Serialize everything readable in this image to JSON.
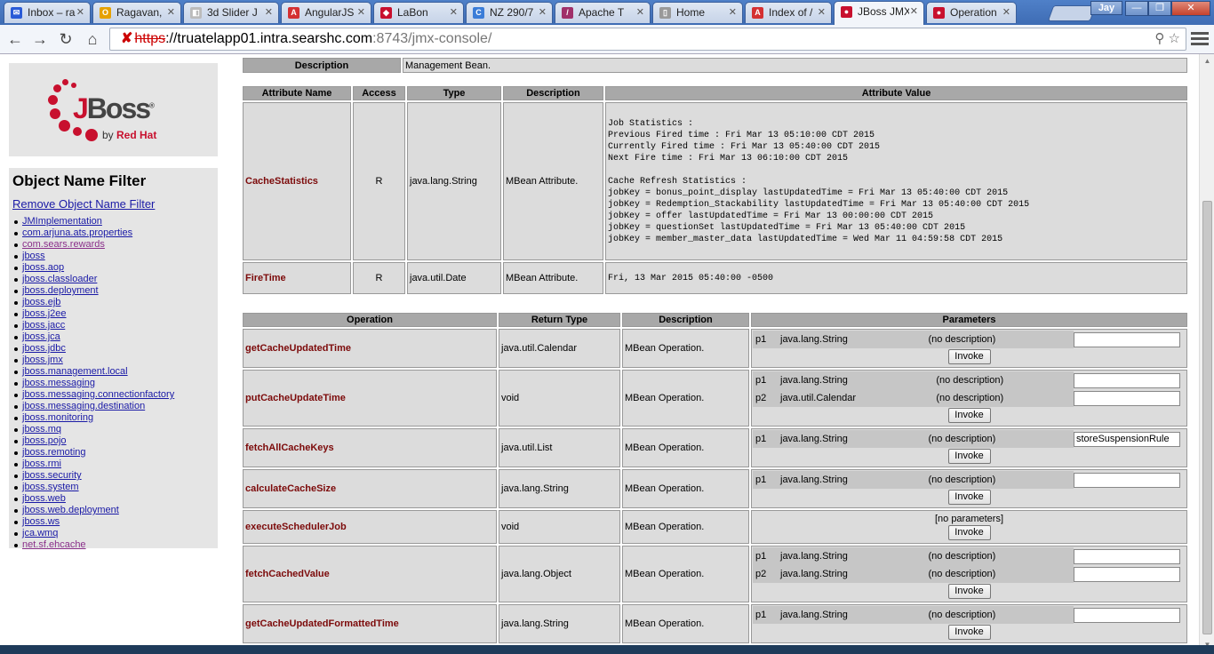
{
  "browser": {
    "tabs": [
      {
        "title": "Inbox – ra",
        "fav_color": "#2a5bd7",
        "fav_glyph": "✉"
      },
      {
        "title": "Ragavan,",
        "fav_color": "#e6a100",
        "fav_glyph": "O"
      },
      {
        "title": "3d Slider J",
        "fav_color": "#bbbbbb",
        "fav_glyph": "◧"
      },
      {
        "title": "AngularJS",
        "fav_color": "#d43032",
        "fav_glyph": "A"
      },
      {
        "title": "LaBon",
        "fav_color": "#c8102e",
        "fav_glyph": "◆"
      },
      {
        "title": "NZ 290/7",
        "fav_color": "#3b7dd8",
        "fav_glyph": "C"
      },
      {
        "title": "Apache T",
        "fav_color": "#a0306a",
        "fav_glyph": "/"
      },
      {
        "title": "Home",
        "fav_color": "#999999",
        "fav_glyph": "▯"
      },
      {
        "title": "Index of /",
        "fav_color": "#d43032",
        "fav_glyph": "A"
      },
      {
        "title": "JBoss JMX",
        "fav_color": "#c8102e",
        "fav_glyph": "●"
      },
      {
        "title": "Operation",
        "fav_color": "#c8102e",
        "fav_glyph": "●"
      }
    ],
    "active_tab_index": 9,
    "user": "Jay",
    "url": {
      "scheme": "https",
      "host": "://truatelapp01.intra.searshc.com",
      "path": ":8743/jmx-console/"
    }
  },
  "logo": {
    "wordmark_a": "J",
    "wordmark_b": "Boss",
    "byline_a": "by ",
    "byline_b": "Red Hat",
    "registered": "®"
  },
  "filter": {
    "heading": "Object Name Filter",
    "remove_label": "Remove Object Name Filter",
    "domains": [
      {
        "name": "JMImplementation",
        "visited": false
      },
      {
        "name": "com.arjuna.ats.properties",
        "visited": false
      },
      {
        "name": "com.sears.rewards",
        "visited": true
      },
      {
        "name": "jboss",
        "visited": false
      },
      {
        "name": "jboss.aop",
        "visited": false
      },
      {
        "name": "jboss.classloader",
        "visited": false
      },
      {
        "name": "jboss.deployment",
        "visited": false
      },
      {
        "name": "jboss.ejb",
        "visited": false
      },
      {
        "name": "jboss.j2ee",
        "visited": false
      },
      {
        "name": "jboss.jacc",
        "visited": false
      },
      {
        "name": "jboss.jca",
        "visited": false
      },
      {
        "name": "jboss.jdbc",
        "visited": false
      },
      {
        "name": "jboss.jmx",
        "visited": false
      },
      {
        "name": "jboss.management.local",
        "visited": false
      },
      {
        "name": "jboss.messaging",
        "visited": false
      },
      {
        "name": "jboss.messaging.connectionfactory",
        "visited": false
      },
      {
        "name": "jboss.messaging.destination",
        "visited": false
      },
      {
        "name": "jboss.monitoring",
        "visited": false
      },
      {
        "name": "jboss.mq",
        "visited": false
      },
      {
        "name": "jboss.pojo",
        "visited": false
      },
      {
        "name": "jboss.remoting",
        "visited": false
      },
      {
        "name": "jboss.rmi",
        "visited": false
      },
      {
        "name": "jboss.security",
        "visited": false
      },
      {
        "name": "jboss.system",
        "visited": false
      },
      {
        "name": "jboss.web",
        "visited": false
      },
      {
        "name": "jboss.web.deployment",
        "visited": false
      },
      {
        "name": "jboss.ws",
        "visited": false
      },
      {
        "name": "jca.wmq",
        "visited": false
      },
      {
        "name": "net.sf.ehcache",
        "visited": true
      }
    ]
  },
  "mbean": {
    "description_label": "Description",
    "description_value": "Management Bean."
  },
  "attributes": {
    "headers": [
      "Attribute Name",
      "Access",
      "Type",
      "Description",
      "Attribute Value"
    ],
    "rows": [
      {
        "name": "CacheStatistics",
        "access": "R",
        "type": "java.lang.String",
        "description": "MBean Attribute.",
        "value": "Job Statistics :\nPrevious Fired time : Fri Mar 13 05:10:00 CDT 2015\nCurrently Fired time : Fri Mar 13 05:40:00 CDT 2015\nNext Fire time : Fri Mar 13 06:10:00 CDT 2015\n\nCache Refresh Statistics :\njobKey = bonus_point_display lastUpdatedTime = Fri Mar 13 05:40:00 CDT 2015\njobKey = Redemption_Stackability lastUpdatedTime = Fri Mar 13 05:40:00 CDT 2015\njobKey = offer lastUpdatedTime = Fri Mar 13 00:00:00 CDT 2015\njobKey = questionSet lastUpdatedTime = Fri Mar 13 05:40:00 CDT 2015\njobKey = member_master_data lastUpdatedTime = Wed Mar 11 04:59:58 CDT 2015"
      },
      {
        "name": "FireTime",
        "access": "R",
        "type": "java.util.Date",
        "description": "MBean Attribute.",
        "value": "Fri, 13 Mar 2015 05:40:00 -0500"
      }
    ]
  },
  "operations": {
    "headers": [
      "Operation",
      "Return Type",
      "Description",
      "Parameters"
    ],
    "invoke_label": "Invoke",
    "no_params_label": "[no parameters]",
    "rows": [
      {
        "name": "getCacheUpdatedTime",
        "return_type": "java.util.Calendar",
        "description": "MBean Operation.",
        "params": [
          {
            "name": "p1",
            "type": "java.lang.String",
            "desc": "(no description)",
            "value": ""
          }
        ]
      },
      {
        "name": "putCacheUpdateTime",
        "return_type": "void",
        "description": "MBean Operation.",
        "params": [
          {
            "name": "p1",
            "type": "java.lang.String",
            "desc": "(no description)",
            "value": ""
          },
          {
            "name": "p2",
            "type": "java.util.Calendar",
            "desc": "(no description)",
            "value": ""
          }
        ]
      },
      {
        "name": "fetchAllCacheKeys",
        "return_type": "java.util.List",
        "description": "MBean Operation.",
        "params": [
          {
            "name": "p1",
            "type": "java.lang.String",
            "desc": "(no description)",
            "value": "storeSuspensionRule"
          }
        ]
      },
      {
        "name": "calculateCacheSize",
        "return_type": "java.lang.String",
        "description": "MBean Operation.",
        "params": [
          {
            "name": "p1",
            "type": "java.lang.String",
            "desc": "(no description)",
            "value": ""
          }
        ]
      },
      {
        "name": "executeSchedulerJob",
        "return_type": "void",
        "description": "MBean Operation.",
        "params": []
      },
      {
        "name": "fetchCachedValue",
        "return_type": "java.lang.Object",
        "description": "MBean Operation.",
        "params": [
          {
            "name": "p1",
            "type": "java.lang.String",
            "desc": "(no description)",
            "value": ""
          },
          {
            "name": "p2",
            "type": "java.lang.String",
            "desc": "(no description)",
            "value": ""
          }
        ]
      },
      {
        "name": "getCacheUpdatedFormattedTime",
        "return_type": "java.lang.String",
        "description": "MBean Operation.",
        "params": [
          {
            "name": "p1",
            "type": "java.lang.String",
            "desc": "(no description)",
            "value": ""
          }
        ]
      }
    ]
  }
}
